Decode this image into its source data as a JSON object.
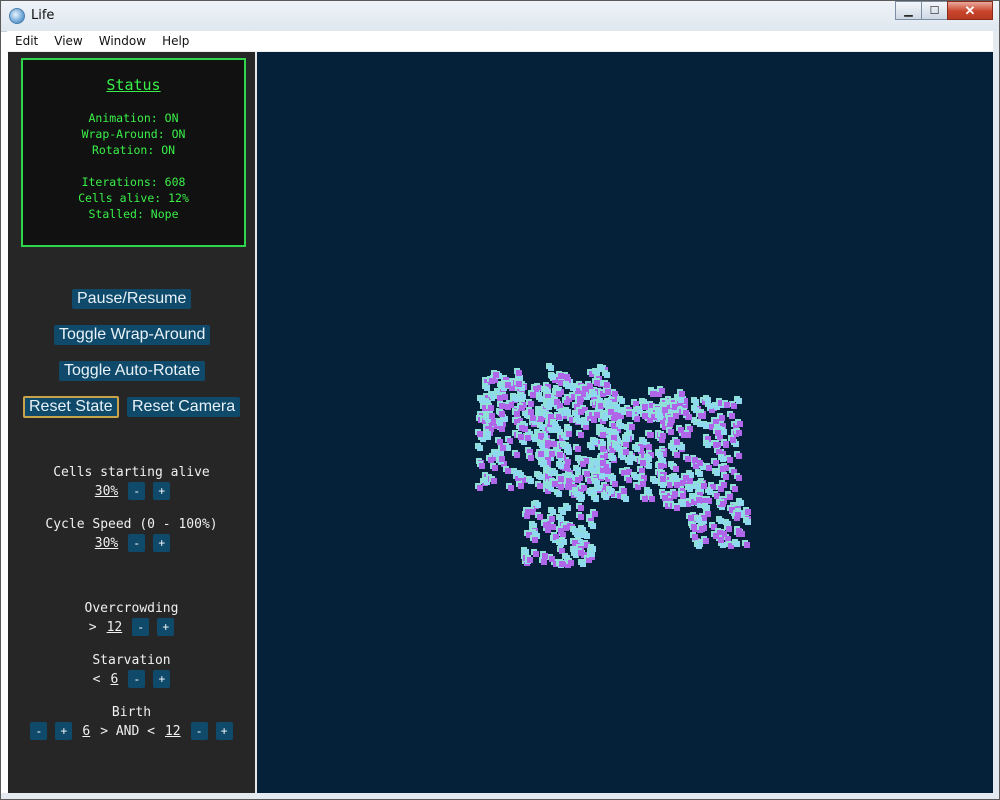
{
  "window": {
    "title": "Life",
    "minimize_icon": "minimize-icon",
    "maximize_icon": "maximize-icon",
    "close_icon": "close-icon"
  },
  "menu": [
    "Edit",
    "View",
    "Window",
    "Help"
  ],
  "status": {
    "title": "Status",
    "animation": "Animation: ON",
    "wrap_around": "Wrap-Around: ON",
    "rotation": "Rotation: ON",
    "iterations": "Iterations: 608",
    "cells_alive": "Cells alive: 12%",
    "stalled": "Stalled: Nope"
  },
  "buttons": {
    "pause_resume": "Pause/Resume",
    "toggle_wrap": "Toggle Wrap-Around",
    "toggle_rotate": "Toggle Auto-Rotate",
    "reset_state": "Reset State",
    "reset_camera": "Reset Camera"
  },
  "controls": {
    "cells_starting_alive": {
      "label": "Cells starting alive",
      "value": "30%"
    },
    "cycle_speed": {
      "label": "Cycle Speed (0 - 100%)",
      "value": "30%"
    },
    "overcrowding": {
      "label": "Overcrowding",
      "op": ">",
      "value": "12"
    },
    "starvation": {
      "label": "Starvation",
      "op": "<",
      "value": "6"
    },
    "birth": {
      "label": "Birth",
      "low": "6",
      "mid": "> AND <",
      "high": "12"
    },
    "minus": "-",
    "plus": "+"
  },
  "colors": {
    "accent": "#0f4a6b",
    "status_green": "#39f048",
    "viewport_bg": "#05213a",
    "cell_top": "#8fe0d6",
    "cell_side": "#b066e8"
  }
}
